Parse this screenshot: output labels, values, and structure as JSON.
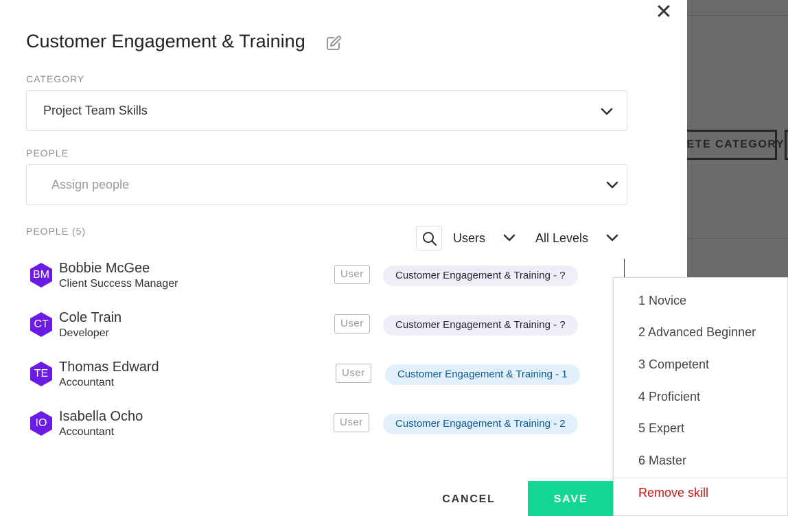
{
  "background": {
    "button_label": "DELETE CATEGORY"
  },
  "modal": {
    "close_label": "✕",
    "title": "Customer Engagement & Training",
    "category": {
      "label": "CATEGORY",
      "value": "Project Team Skills"
    },
    "people_field": {
      "label": "PEOPLE",
      "placeholder": "Assign people"
    },
    "people_list": {
      "label": "PEOPLE (5)",
      "filters": {
        "role_filter": "Users",
        "level_filter": "All Levels"
      },
      "items": [
        {
          "initials": "BM",
          "name": "Bobbie McGee",
          "role": "Client Success Manager",
          "tag": "User",
          "skill": "Customer Engagement & Training - ?",
          "level_set": false
        },
        {
          "initials": "CT",
          "name": "Cole Train",
          "role": "Developer",
          "tag": "User",
          "skill": "Customer Engagement & Training - ?",
          "level_set": false
        },
        {
          "initials": "TE",
          "name": "Thomas Edward",
          "role": "Accountant",
          "tag": "User",
          "skill": "Customer Engagement & Training - 1",
          "level_set": true
        },
        {
          "initials": "IO",
          "name": "Isabella Ocho",
          "role": "Accountant",
          "tag": "User",
          "skill": "Customer Engagement & Training - 2",
          "level_set": true
        }
      ]
    },
    "footer": {
      "cancel_label": "CANCEL",
      "save_label": "SAVE"
    }
  },
  "level_menu": {
    "options": [
      "1 Novice",
      "2 Advanced Beginner",
      "3 Competent",
      "4 Proficient",
      "5 Expert",
      "6 Master"
    ],
    "remove_label": "Remove skill"
  },
  "colors": {
    "avatar": "#6a1ce6",
    "save_button": "#12d893",
    "remove_text": "#d01616",
    "skill_unset_bg": "#eeedf8",
    "skill_set_bg": "#e2f0fb",
    "skill_set_text": "#0f5a94"
  },
  "icons": {
    "close": "close-icon",
    "edit": "pencil-edit-icon",
    "dropdown": "chevron-down-icon",
    "search": "search-icon",
    "avatar": "hexagon-avatar"
  }
}
